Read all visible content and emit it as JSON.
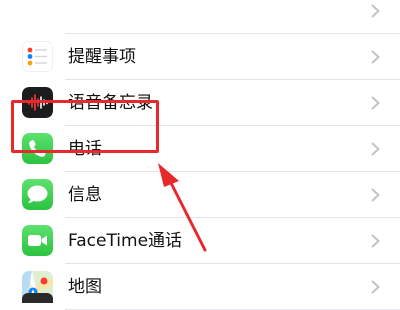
{
  "settings_list": {
    "items": [
      {
        "label": "",
        "icon": "app-icon-partial"
      },
      {
        "label": "提醒事项",
        "icon": "reminders-icon"
      },
      {
        "label": "语音备忘录",
        "icon": "voice-memos-icon"
      },
      {
        "label": "电话",
        "icon": "phone-icon"
      },
      {
        "label": "信息",
        "icon": "messages-icon"
      },
      {
        "label": "FaceTime通话",
        "icon": "facetime-icon"
      },
      {
        "label": "地图",
        "icon": "maps-icon"
      }
    ]
  },
  "annotation": {
    "highlight_color": "#e8292c",
    "highlighted_item": "电话"
  }
}
